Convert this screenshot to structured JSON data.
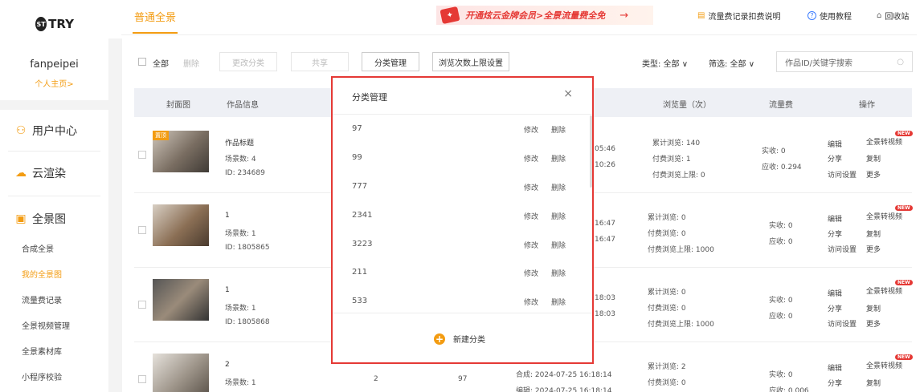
{
  "sidebar": {
    "logo_text": "TRY",
    "logo_mark": "ST",
    "username": "fanpeipei",
    "homepage_link": "个人主页>",
    "sections": [
      {
        "label": "用户中心",
        "icon": "user-icon"
      },
      {
        "label": "云渲染",
        "icon": "cloud-icon"
      },
      {
        "label": "全景图",
        "icon": "image-icon"
      }
    ],
    "sub_items": [
      "合成全景",
      "我的全景图",
      "流量费记录",
      "全景视频管理",
      "全景素材库",
      "小程序校验"
    ],
    "active_sub": "我的全景图"
  },
  "topbar": {
    "tab_title": "普通全景",
    "promo_text": "开通炫云金牌会员>全景流量费全免",
    "promo_arrow": "→",
    "links": [
      {
        "label": "流量费记录扣费说明",
        "icon": "receipt-icon"
      },
      {
        "label": "使用教程",
        "icon": "help-icon"
      },
      {
        "label": "回收站",
        "icon": "trash-icon"
      }
    ]
  },
  "toolbar": {
    "select_all": "全部",
    "delete": "删除",
    "change_category": "更改分类",
    "share": "共享",
    "category_manage": "分类管理",
    "browse_limit": "浏览次数上限设置",
    "type_filter": "类型: 全部",
    "screen_filter": "筛选: 全部",
    "search_placeholder": "作品ID/关键字搜索"
  },
  "table": {
    "headers": [
      "封面图",
      "作品信息",
      "浏览量（次）",
      "流量费",
      "操作"
    ],
    "rows": [
      {
        "badge": "置顶",
        "title": "作品标题",
        "scenes": "场景数: 4",
        "id": "ID: 234689",
        "times": [
          "05:46",
          "10:26"
        ],
        "total_views": "累计浏览: 140",
        "paid_views": "付费浏览: 1",
        "paid_limit": "付费浏览上限: 0",
        "actual": "实收: 0",
        "due": "应收: 0.294"
      },
      {
        "badge": "",
        "title": "1",
        "scenes": "场景数: 1",
        "id": "ID: 1805865",
        "times": [
          "16:47",
          "16:47"
        ],
        "total_views": "累计浏览: 0",
        "paid_views": "付费浏览: 0",
        "paid_limit": "付费浏览上限: 1000",
        "actual": "实收: 0",
        "due": "应收: 0"
      },
      {
        "badge": "",
        "title": "1",
        "scenes": "场景数: 1",
        "id": "ID: 1805868",
        "times": [
          "18:03",
          "18:03"
        ],
        "total_views": "累计浏览: 0",
        "paid_views": "付费浏览: 0",
        "paid_limit": "付费浏览上限: 1000",
        "actual": "实收: 0",
        "due": "应收: 0"
      },
      {
        "badge": "",
        "title": "2",
        "scenes": "场景数: 1",
        "id": "",
        "col3": "2",
        "col4": "97",
        "times": [
          "合成: 2024-07-25 16:18:14",
          "编辑: 2024-07-25 16:18:14"
        ],
        "total_views": "累计浏览: 2",
        "paid_views": "付费浏览: 0",
        "paid_limit": "",
        "actual": "实收: 0",
        "due": "应收: 0.006"
      }
    ],
    "ops": {
      "edit": "编辑",
      "to_video": "全景转视频",
      "share": "分享",
      "copy": "复制",
      "access": "访问设置",
      "more": "更多",
      "new_badge": "NEW"
    }
  },
  "modal": {
    "title": "分类管理",
    "close": "×",
    "categories": [
      "97",
      "99",
      "777",
      "2341",
      "3223",
      "211",
      "533"
    ],
    "edit_label": "修改",
    "delete_label": "删除",
    "new_category": "新建分类"
  }
}
